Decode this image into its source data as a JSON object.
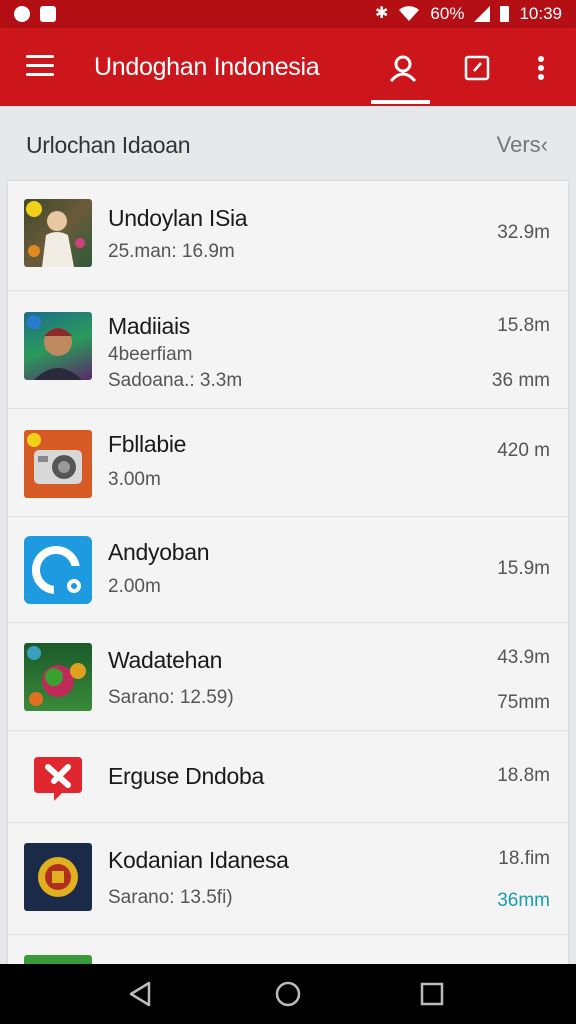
{
  "status_bar": {
    "battery_text": "60%",
    "time": "10:39",
    "icons": [
      "notification-icon",
      "image-icon",
      "bluetooth-icon",
      "wifi-icon",
      "signal-icon",
      "battery-icon"
    ]
  },
  "app_bar": {
    "title": "Undoghan Indonesia",
    "color": "#cc161c",
    "icons": [
      "menu-icon",
      "account-icon",
      "edit-icon",
      "more-vert-icon"
    ]
  },
  "sub_header": {
    "title": "Urlochan Idaoan",
    "action": "Vers‹"
  },
  "items": [
    {
      "name": "Undoylan ISia",
      "sub1": "25.man: 16.9m",
      "sub2": "",
      "size1": "32.9m",
      "size2": "",
      "icon": "portrait-art-icon"
    },
    {
      "name": "Madiiais",
      "sub1": "4beerfiam",
      "sub2": "Sadoana.: 3.3m",
      "size1": "15.8m",
      "size2": "36 mm",
      "icon": "avatar-art-icon"
    },
    {
      "name": "Fbllabie",
      "sub1": "3.00m",
      "sub2": "",
      "size1": "420 m",
      "size2": "",
      "icon": "camera-icon"
    },
    {
      "name": "Andyoban",
      "sub1": "2.00m",
      "sub2": "",
      "size1": "15.9m",
      "size2": "",
      "icon": "chat-bubble-icon"
    },
    {
      "name": "Wadatehan",
      "sub1": "Sarano: 12.59)",
      "sub2": "",
      "size1": "43.9m",
      "size2": "75mm",
      "icon": "game-balls-icon"
    },
    {
      "name": "Erguse Dndoba",
      "sub1": "",
      "sub2": "",
      "size1": "18.8m",
      "size2": "",
      "icon": "x-badge-icon"
    },
    {
      "name": "Kodanian Idanesa",
      "sub1": "Sarano: 13.5fi)",
      "sub2": "",
      "size1": "18.fim",
      "size2": "36mm",
      "size2_color": "#1a9bb5",
      "icon": "emblem-icon"
    }
  ],
  "nav_bar": {
    "icons": [
      "back-icon",
      "home-icon",
      "recents-icon"
    ]
  }
}
